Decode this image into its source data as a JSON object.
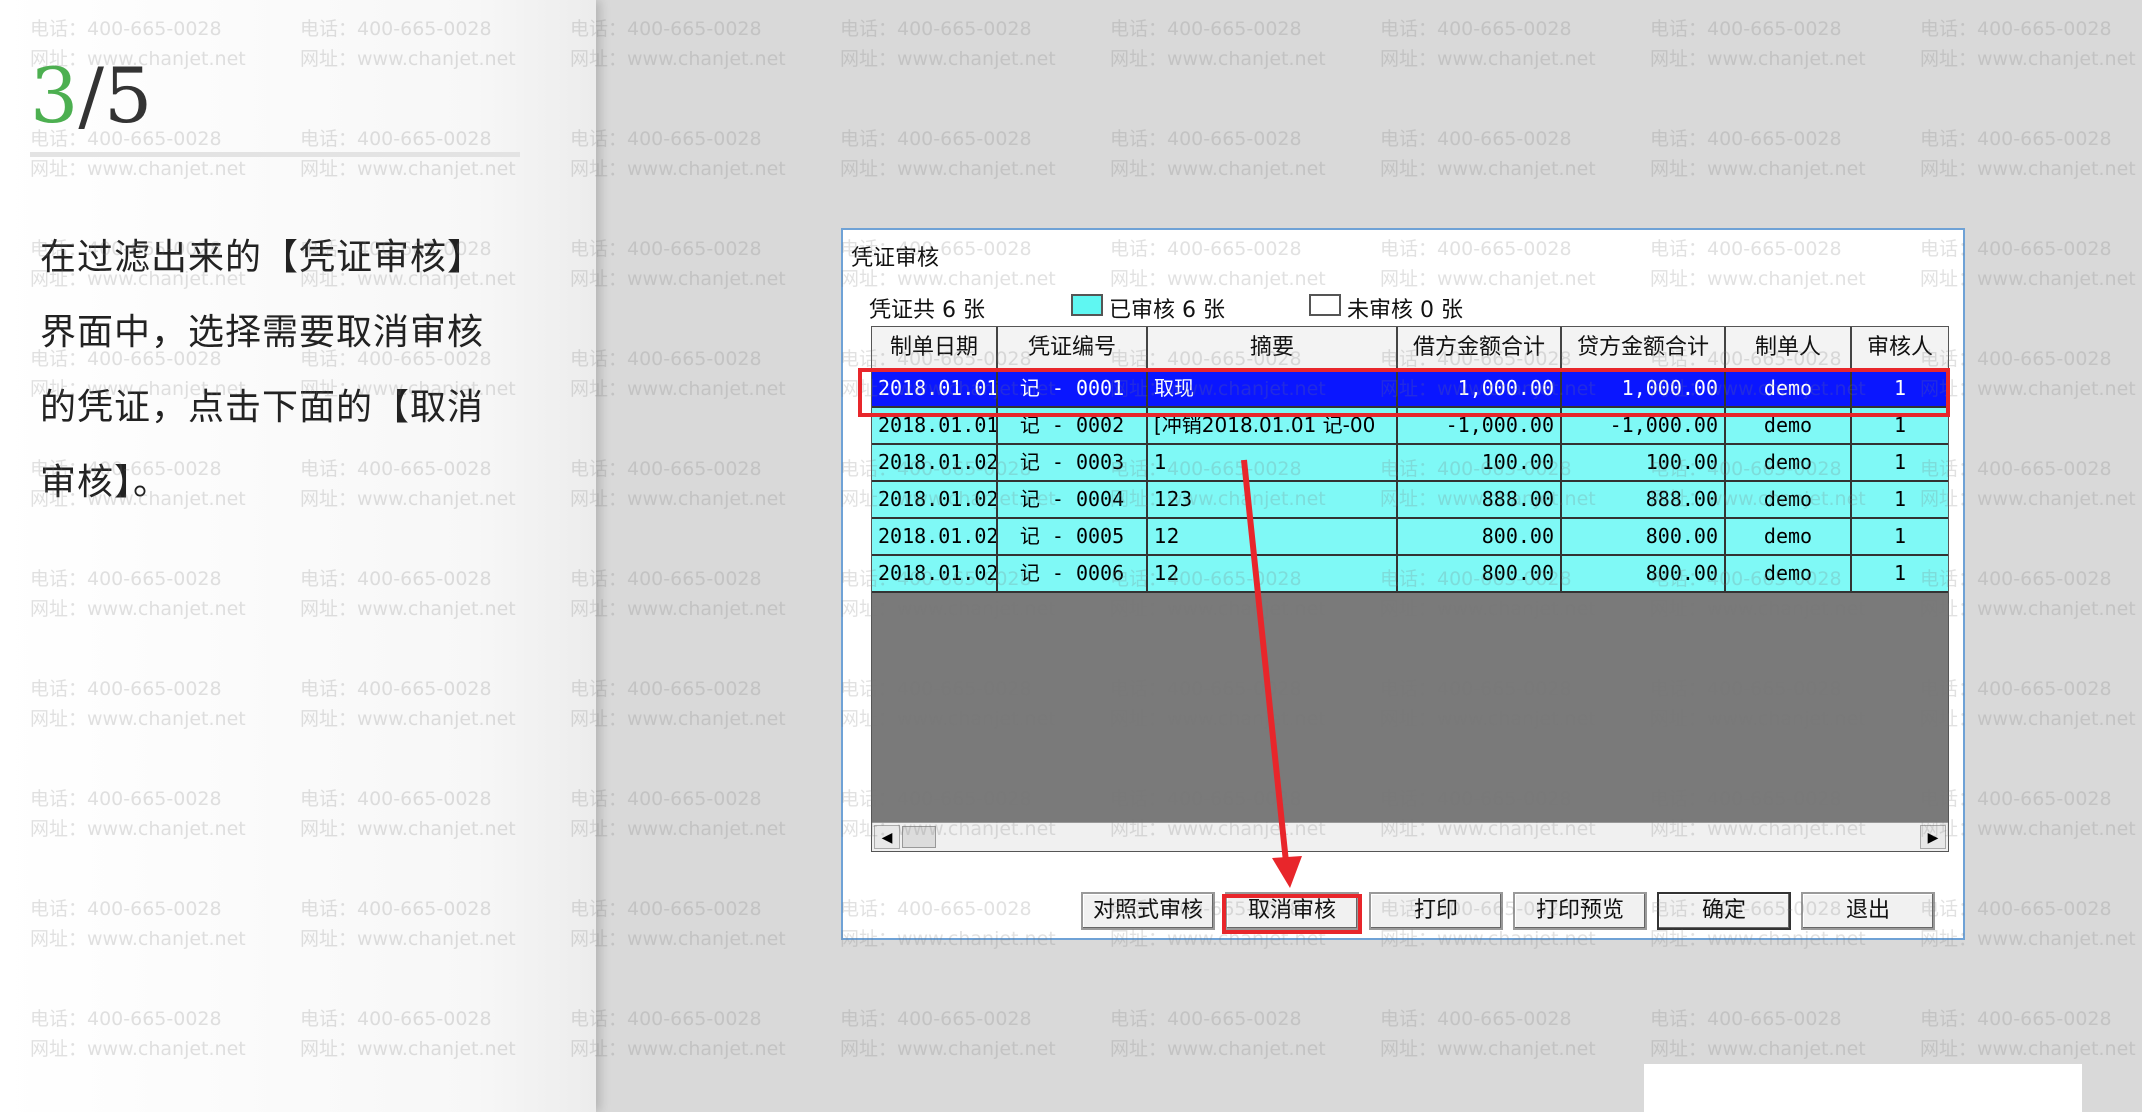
{
  "left_panel": {
    "step_current": "3",
    "step_total": "/5",
    "instruction_lines": [
      "在过滤出来的【凭证审核】",
      "界面中，选择需要取消审核",
      "的凭证，点击下面的【取消",
      "审核】。"
    ]
  },
  "watermark": {
    "phone": "电话：400-665-0028",
    "site": "网址：www.chanjet.net"
  },
  "dialog": {
    "title": "凭证审核",
    "summary_total": "凭证共 6 张",
    "legend_audited": "已审核 6 张",
    "legend_unaudited": "未审核 0 张",
    "colors": {
      "audited": "#5ff7f2",
      "selected_row": "#0a16ff",
      "highlight": "#e8262b"
    },
    "columns": [
      "制单日期",
      "凭证编号",
      "摘要",
      "借方金额合计",
      "贷方金额合计",
      "制单人",
      "审核人"
    ],
    "rows": [
      {
        "date": "2018.01.01",
        "number": "记 - 0001",
        "summary": "取现",
        "debit": "1,000.00",
        "credit": "1,000.00",
        "maker": "demo",
        "auditor": "1"
      },
      {
        "date": "2018.01.01",
        "number": "记 - 0002",
        "summary": "[冲销2018.01.01 记-00",
        "debit": "-1,000.00",
        "credit": "-1,000.00",
        "maker": "demo",
        "auditor": "1"
      },
      {
        "date": "2018.01.02",
        "number": "记 - 0003",
        "summary": "1",
        "debit": "100.00",
        "credit": "100.00",
        "maker": "demo",
        "auditor": "1"
      },
      {
        "date": "2018.01.02",
        "number": "记 - 0004",
        "summary": "123",
        "debit": "888.00",
        "credit": "888.00",
        "maker": "demo",
        "auditor": "1"
      },
      {
        "date": "2018.01.02",
        "number": "记 - 0005",
        "summary": "12",
        "debit": "800.00",
        "credit": "800.00",
        "maker": "demo",
        "auditor": "1"
      },
      {
        "date": "2018.01.02",
        "number": "记 - 0006",
        "summary": "12",
        "debit": "800.00",
        "credit": "800.00",
        "maker": "demo",
        "auditor": "1"
      }
    ],
    "scroll_left_icon": "◀",
    "scroll_right_icon": "▶",
    "buttons": {
      "compare_audit": "对照式审核",
      "cancel_audit": "取消审核",
      "print": "打印",
      "print_preview": "打印预览",
      "ok": "确定",
      "exit": "退出"
    }
  }
}
